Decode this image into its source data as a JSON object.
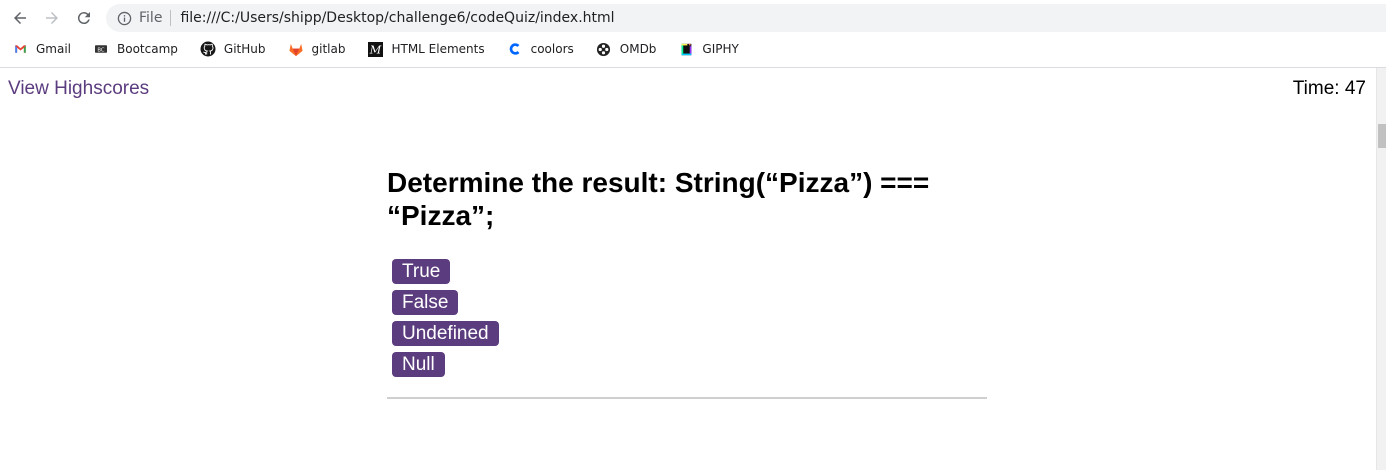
{
  "browser": {
    "omnibox": {
      "scheme_label": "File",
      "url": "file:///C:/Users/shipp/Desktop/challenge6/codeQuiz/index.html"
    },
    "bookmarks": [
      {
        "label": "Gmail",
        "icon": "gmail-icon"
      },
      {
        "label": "Bootcamp",
        "icon": "bootcamp-icon"
      },
      {
        "label": "GitHub",
        "icon": "github-icon"
      },
      {
        "label": "gitlab",
        "icon": "gitlab-icon"
      },
      {
        "label": "HTML Elements",
        "icon": "html-elements-icon"
      },
      {
        "label": "coolors",
        "icon": "coolors-icon"
      },
      {
        "label": "OMDb",
        "icon": "omdb-icon"
      },
      {
        "label": "GIPHY",
        "icon": "giphy-icon"
      }
    ]
  },
  "header": {
    "highscores_link": "View Highscores",
    "timer_label": "Time:",
    "timer_value": "47"
  },
  "quiz": {
    "question": "Determine the result: String(“Pizza”) === “Pizza”;",
    "choices": [
      "True",
      "False",
      "Undefined",
      "Null"
    ]
  },
  "colors": {
    "accent": "#5b3c7e",
    "button_text": "#ffffff"
  }
}
